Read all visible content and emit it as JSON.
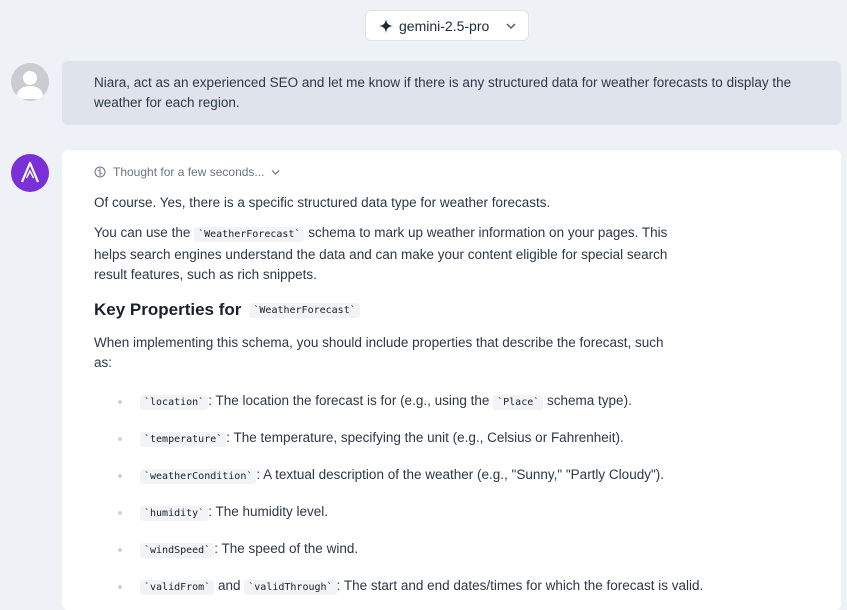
{
  "model": {
    "name": "gemini-2.5-pro"
  },
  "user_message": {
    "text": "Niara, act as an experienced SEO and let me know if there is any structured data for weather forecasts to display the weather for each region."
  },
  "response": {
    "thought_label": "Thought for a few seconds...",
    "intro": "Of course. Yes, there is a specific structured data type for weather forecasts.",
    "para2_pre": "You can use the ",
    "para2_code": "`WeatherForecast`",
    "para2_post": " schema to mark up weather information on your pages. This helps search engines understand the data and can make your content eligible for special search result features, such as rich snippets.",
    "heading_text": "Key Properties for",
    "heading_code": "`WeatherForecast`",
    "lead": "When implementing this schema, you should include properties that describe the forecast, such as:",
    "items": [
      {
        "code": "`location`",
        "text_pre": ": The location the forecast is for (e.g., using the ",
        "code2": "`Place`",
        "text_post": " schema type)."
      },
      {
        "code": "`temperature`",
        "text_pre": ": The temperature, specifying the unit (e.g., Celsius or Fahrenheit)."
      },
      {
        "code": "`weatherCondition`",
        "text_pre": ": A textual description of the weather (e.g., \"Sunny,\" \"Partly Cloudy\")."
      },
      {
        "code": "`humidity`",
        "text_pre": ": The humidity level."
      },
      {
        "code": "`windSpeed`",
        "text_pre": ": The speed of the wind."
      },
      {
        "code": "`validFrom`",
        "text_pre": " and ",
        "code2": "`validThrough`",
        "text_post": ": The start and end dates/times for which the forecast is valid."
      }
    ]
  },
  "colors": {
    "ai_avatar": "#7b2fd6",
    "user_bubble": "#dfe4ec",
    "background": "#eef1f5"
  }
}
